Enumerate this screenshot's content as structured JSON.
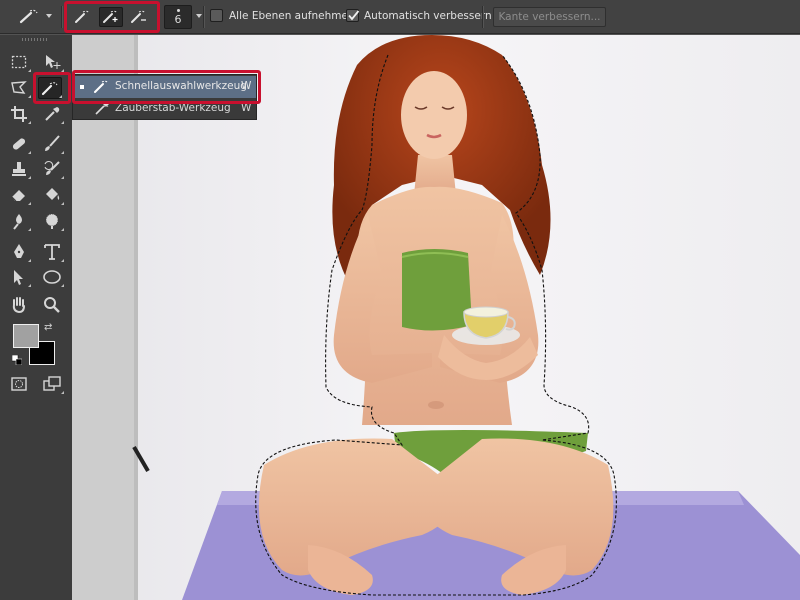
{
  "options_bar": {
    "brush_size": "6",
    "sample_all_layers_label": "Alle Ebenen aufnehmen",
    "sample_all_layers_checked": false,
    "auto_enhance_label": "Automatisch verbessern",
    "auto_enhance_checked": true,
    "refine_edge_label": "Kante verbessern..."
  },
  "flyout": {
    "items": [
      {
        "label": "Schnellauswahlwerkzeug",
        "shortcut": "W",
        "selected": true
      },
      {
        "label": "Zauberstab-Werkzeug",
        "shortcut": "W",
        "selected": false
      }
    ]
  },
  "colors": {
    "highlight": "#c8102e",
    "foreground": "#a1a1a1",
    "background": "#000000",
    "menu_selection": "#5d6f86"
  },
  "toolbox_icons": [
    "marquee-icon",
    "move-icon",
    "lasso-icon",
    "quick-selection-icon",
    "crop-icon",
    "eyedropper-icon",
    "healing-icon",
    "brush-icon",
    "stamp-icon",
    "history-brush-icon",
    "eraser-icon",
    "paint-bucket-icon",
    "blur-icon",
    "dodge-icon",
    "pen-icon",
    "type-icon",
    "path-selection-icon",
    "ellipse-icon",
    "hand-icon",
    "zoom-icon"
  ]
}
